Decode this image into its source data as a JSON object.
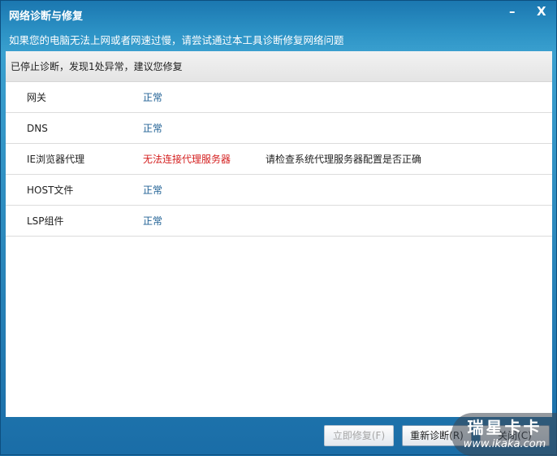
{
  "window": {
    "title": "网络诊断与修复",
    "subtitle": "如果您的电脑无法上网或者网速过慢，请尝试通过本工具诊断修复网络问题",
    "minimize": "–",
    "close": "X"
  },
  "status": "已停止诊断，发现1处异常，建议您修复",
  "rows": [
    {
      "name": "网关",
      "result": "正常",
      "advice": ""
    },
    {
      "name": "DNS",
      "result": "正常",
      "advice": ""
    },
    {
      "name": "IE浏览器代理",
      "result": "无法连接代理服务器",
      "advice": "请检查系统代理服务器配置是否正确"
    },
    {
      "name": "HOST文件",
      "result": "正常",
      "advice": ""
    },
    {
      "name": "LSP组件",
      "result": "正常",
      "advice": ""
    }
  ],
  "buttons": {
    "fix": "立即修复(F)",
    "rediagnose": "重新诊断(R)",
    "close": "关闭(C)"
  },
  "watermark": {
    "brand": "瑞星卡卡",
    "url": "www.ikaka.com"
  }
}
